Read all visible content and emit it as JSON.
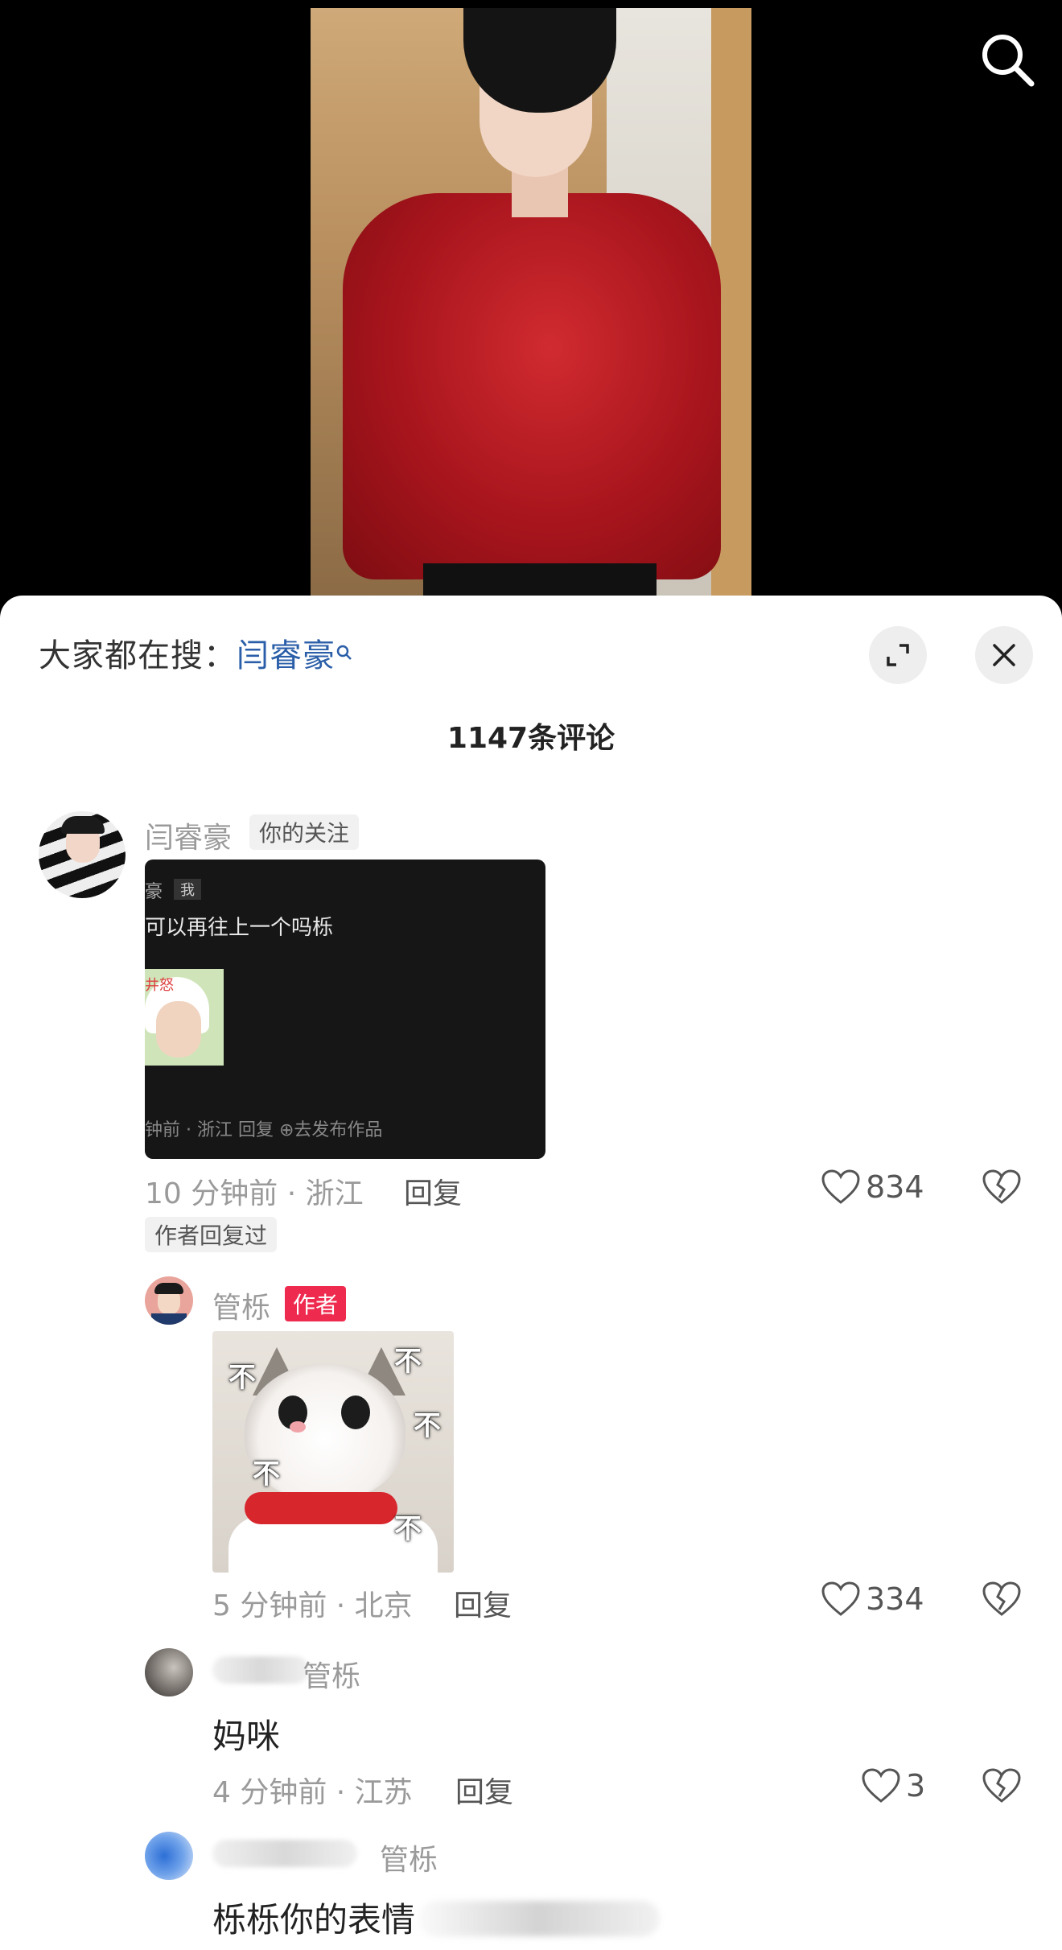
{
  "top_bar": {
    "search_icon": "search-icon"
  },
  "panel": {
    "hot_search_prefix": "大家都在搜：",
    "hot_search_keyword": "闫睿豪",
    "expand_icon": "expand-icon",
    "close_icon": "close-icon",
    "comment_count": "1147条评论"
  },
  "comments": [
    {
      "author": "闫睿豪",
      "follow_tag": "你的关注",
      "attached_screenshot": {
        "name_fragment": "豪",
        "me_tag": "我",
        "text": "可以再往上一个吗栎",
        "thumb_label": "井怒",
        "meta": "钟前 · 浙江      回复      ⊕去发布作品"
      },
      "time_location": "10 分钟前 · 浙江",
      "reply_label": "回复",
      "likes": "834",
      "author_replied_tag": "作者回复过"
    },
    {
      "author": "管栎",
      "author_tag": "作者",
      "sticker_text": "不",
      "time_location": "5 分钟前 · 北京",
      "reply_label": "回复",
      "likes": "334"
    },
    {
      "author_suffix": "管栎",
      "text": "妈咪",
      "time_location": "4 分钟前 · 江苏",
      "reply_label": "回复",
      "likes": "3"
    },
    {
      "author_suffix": "管栎",
      "text": "栎栎你的表情"
    }
  ],
  "colors": {
    "accent_red": "#ef2a4f",
    "keyword_blue": "#2a5ea8"
  }
}
